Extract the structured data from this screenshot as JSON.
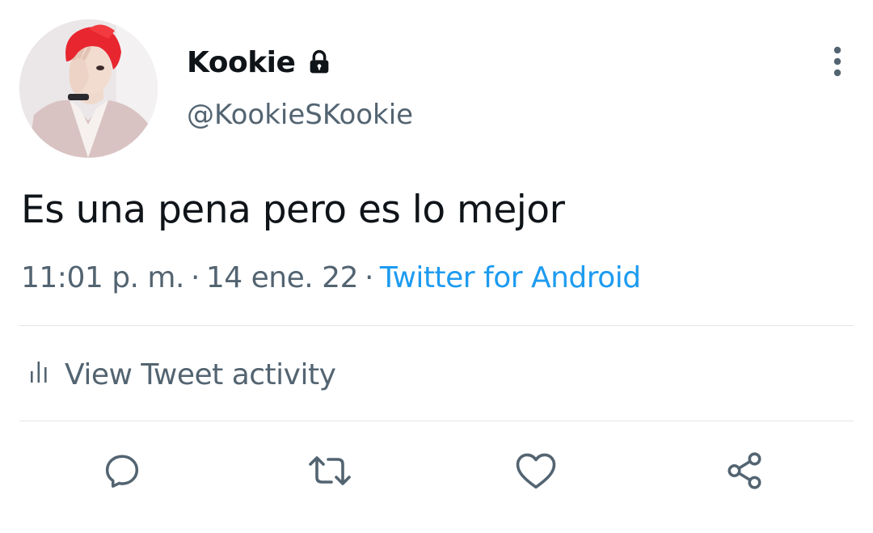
{
  "tweet": {
    "author": {
      "display_name": "Kookie",
      "handle": "@KookieSKookie",
      "protected_icon": "lock-icon",
      "avatar": "profile-photo"
    },
    "more_icon": "more-vertical-icon",
    "text": "Es una pena pero es lo mejor",
    "time": "11:01 p. m.",
    "separator": "·",
    "date": "14 ene. 22",
    "source": "Twitter for Android",
    "activity": {
      "icon": "bar-chart-icon",
      "label": "View Tweet activity"
    },
    "actions": [
      {
        "name": "reply",
        "icon": "reply-icon"
      },
      {
        "name": "retweet",
        "icon": "retweet-icon"
      },
      {
        "name": "like",
        "icon": "heart-icon"
      },
      {
        "name": "share",
        "icon": "share-icon"
      }
    ]
  },
  "colors": {
    "text": "#0f1419",
    "secondary": "#536471",
    "link": "#1d9bf0",
    "divider": "#e1e5e8",
    "background": "#ffffff"
  }
}
